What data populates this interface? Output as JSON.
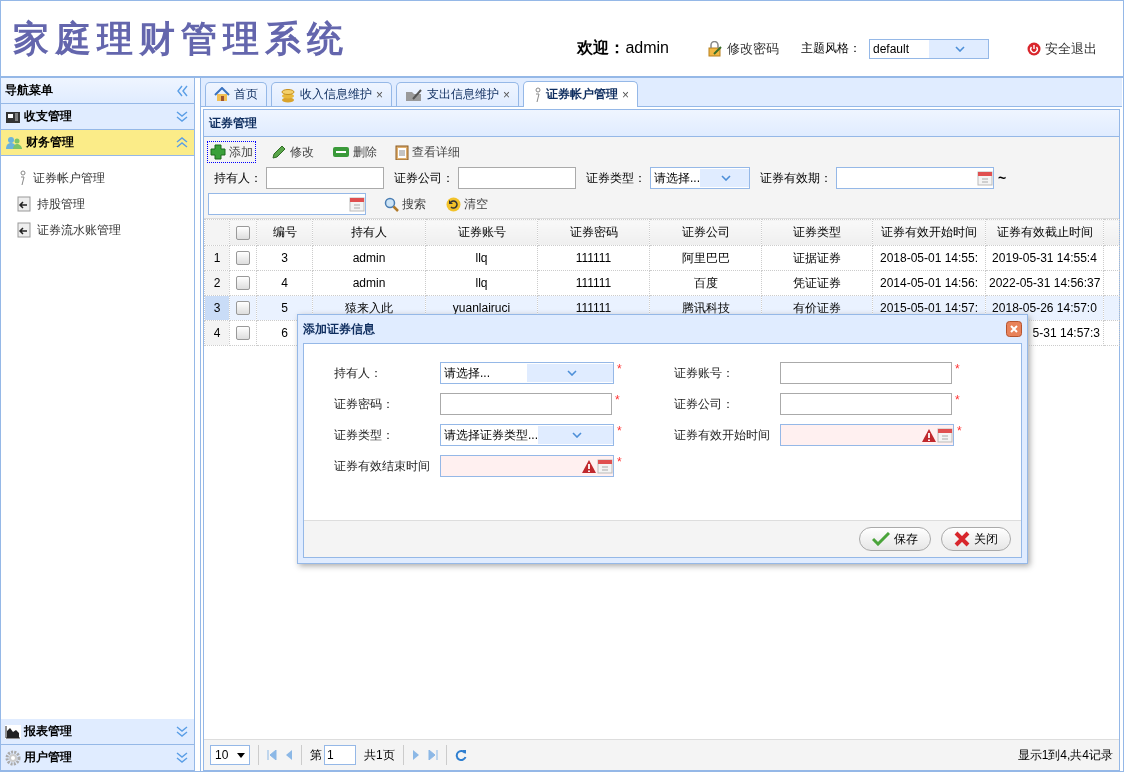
{
  "header": {
    "title": "家庭理财管理系统",
    "welcome": "**欢迎：**admin",
    "change_password": "修改密码",
    "theme_label": "主题风格：",
    "theme_value": "default",
    "logout": "安全退出"
  },
  "sidebar": {
    "title": "导航菜单",
    "sections": [
      {
        "label": "收支管理",
        "expanded": false
      },
      {
        "label": "财务管理",
        "expanded": true,
        "items": [
          {
            "label": "证券帐户管理"
          },
          {
            "label": "持股管理"
          },
          {
            "label": "证券流水账管理"
          }
        ]
      },
      {
        "label": "报表管理",
        "expanded": false
      },
      {
        "label": "用户管理",
        "expanded": false
      }
    ]
  },
  "tabs": [
    {
      "label": "首页",
      "selected": false,
      "closable": false
    },
    {
      "label": "收入信息维护",
      "selected": false,
      "closable": true
    },
    {
      "label": "支出信息维护",
      "selected": false,
      "closable": true
    },
    {
      "label": "证券帐户管理",
      "selected": true,
      "closable": true
    }
  ],
  "close_mark": "×",
  "panel": {
    "title": "证券管理",
    "toolbar": [
      {
        "label": "添加",
        "focused": true
      },
      {
        "label": "修改",
        "focused": false
      },
      {
        "label": "删除",
        "focused": false
      },
      {
        "label": "查看详细",
        "focused": false
      }
    ],
    "filters": [
      {
        "label": "持有人：",
        "kind": "text"
      },
      {
        "label": "证券公司：",
        "kind": "text"
      },
      {
        "label": "证券类型：",
        "kind": "select",
        "value": "请选择..."
      },
      {
        "label": "证券有效期：",
        "kind": "date"
      },
      {
        "label": "~",
        "kind": "separator"
      },
      {
        "kind": "date"
      },
      {
        "label": "搜索",
        "kind": "button"
      },
      {
        "label": "清空",
        "kind": "button"
      }
    ],
    "all_checked": false,
    "columns": [
      "编号",
      "持有人",
      "证券账号",
      "证券密码",
      "证券公司",
      "证券类型",
      "证券有效开始时间",
      "证券有效截止时间"
    ],
    "rows": [
      {
        "index": "1",
        "selected": false,
        "checked": false,
        "cells": [
          "3",
          "admin",
          "llq",
          "111111",
          "阿里巴巴",
          "证据证券",
          "2018-05-01 14:55:",
          "2019-05-31 14:55:4"
        ]
      },
      {
        "index": "2",
        "selected": false,
        "checked": false,
        "cells": [
          "4",
          "admin",
          "llq",
          "111111",
          "百度",
          "凭证证券",
          "2014-05-01 14:56:",
          "2022-05-31 14:56:37"
        ]
      },
      {
        "index": "3",
        "selected": true,
        "checked": false,
        "cells": [
          "5",
          "猿来入此",
          "yuanlairuci",
          "111111",
          "腾讯科技",
          "有价证券",
          "2015-05-01 14:57:",
          "2018-05-26 14:57:0"
        ]
      },
      {
        "index": "4",
        "selected": false,
        "checked": false,
        "cells": [
          "6",
          "",
          "",
          "",
          "",
          "",
          "",
          "5-31 14:57:3"
        ]
      }
    ],
    "pager": {
      "page_size": "10",
      "page_prefix": "第",
      "page": "1",
      "page_total": "共1页",
      "info": "显示1到4,共4记录"
    }
  },
  "dialog": {
    "title": "添加证券信息",
    "fields": [
      {
        "label": "持有人：",
        "kind": "select",
        "value": "请选择...",
        "required": true
      },
      {
        "label": "证券账号：",
        "kind": "text",
        "required": true
      },
      {
        "label": "证券密码：",
        "kind": "text",
        "required": true
      },
      {
        "label": "证券公司：",
        "kind": "text",
        "required": true
      },
      {
        "label": "证券类型：",
        "kind": "select",
        "value": "请选择证券类型...",
        "required": true
      },
      {
        "label": "证券有效开始时间",
        "kind": "date",
        "invalid": true,
        "required": true
      },
      {
        "label": "证券有效结束时间",
        "kind": "date",
        "invalid": true,
        "required": true
      }
    ],
    "required_mark": "*",
    "buttons": [
      {
        "label": "保存"
      },
      {
        "label": "关闭"
      }
    ]
  }
}
